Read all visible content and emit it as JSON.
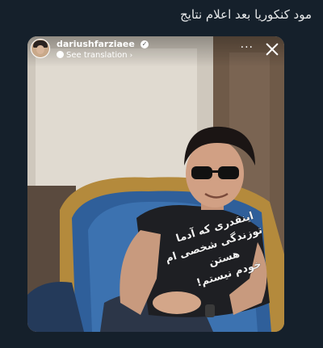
{
  "tweet": {
    "text": "مود کنکوریا بعد اعلام نتایج"
  },
  "story": {
    "username": "dariushfarziaee",
    "see_translation": "See translation",
    "avatar_icon": "profile-avatar",
    "verified_icon": "verified-badge-icon",
    "more_icon": "ellipsis-icon",
    "close_icon": "close-icon"
  },
  "shirt": {
    "lines": [
      "اینقدری که آدما",
      "توزندگی شخصی ام",
      "هستن",
      "خودم نیستم!"
    ]
  }
}
